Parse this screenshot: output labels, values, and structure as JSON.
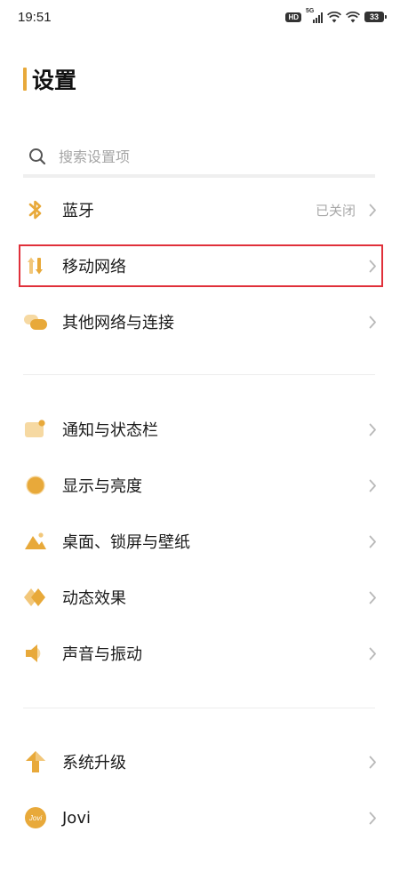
{
  "status_bar": {
    "time": "19:51",
    "hd": "HD",
    "network": "5G",
    "battery": "33"
  },
  "page": {
    "title": "设置"
  },
  "search": {
    "placeholder": "搜索设置项"
  },
  "items": [
    {
      "label": "蓝牙",
      "value": "已关闭",
      "icon": "bluetooth-icon"
    },
    {
      "label": "移动网络",
      "value": "",
      "icon": "mobile-data-icon"
    },
    {
      "label": "其他网络与连接",
      "value": "",
      "icon": "connections-icon"
    },
    {
      "label": "通知与状态栏",
      "value": "",
      "icon": "notification-icon"
    },
    {
      "label": "显示与亮度",
      "value": "",
      "icon": "brightness-icon"
    },
    {
      "label": "桌面、锁屏与壁纸",
      "value": "",
      "icon": "wallpaper-icon"
    },
    {
      "label": "动态效果",
      "value": "",
      "icon": "animation-icon"
    },
    {
      "label": "声音与振动",
      "value": "",
      "icon": "sound-icon"
    },
    {
      "label": "系统升级",
      "value": "",
      "icon": "upgrade-icon"
    },
    {
      "label": "Jovi",
      "value": "",
      "icon": "jovi-icon",
      "icon_text": "Jovi"
    }
  ],
  "colors": {
    "accent": "#e8a93a",
    "highlight_border": "#e0303a",
    "chevron": "#b8b8b8"
  }
}
